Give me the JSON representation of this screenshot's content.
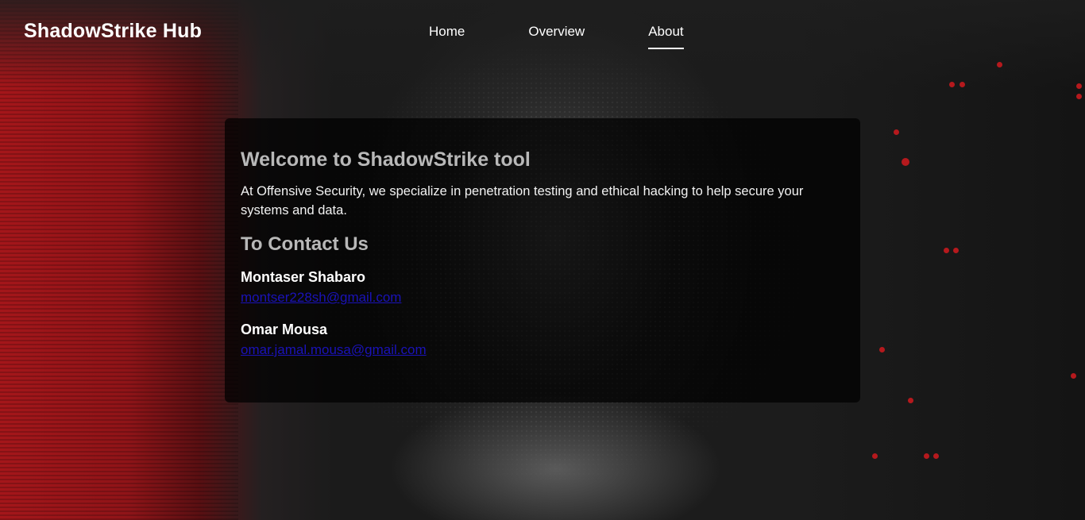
{
  "header": {
    "brand": "ShadowStrike Hub",
    "nav": [
      {
        "label": "Home",
        "active": false
      },
      {
        "label": "Overview",
        "active": false
      },
      {
        "label": "About",
        "active": true
      }
    ]
  },
  "main": {
    "title": "Welcome to ShadowStrike tool",
    "intro": "At Offensive Security, we specialize in penetration testing and ethical hacking to help secure your systems and data.",
    "contact_heading": "To Contact Us",
    "contacts": [
      {
        "name": "Montaser Shabaro",
        "email": "montser228sh@gmail.com"
      },
      {
        "name": "Omar Mousa",
        "email": "omar.jamal.mousa@gmail.com"
      }
    ]
  },
  "colors": {
    "accent_red": "#a4161a",
    "card_background": "#000000",
    "heading_gray": "#b8b8b8",
    "link_blue": "#1a12b8"
  }
}
